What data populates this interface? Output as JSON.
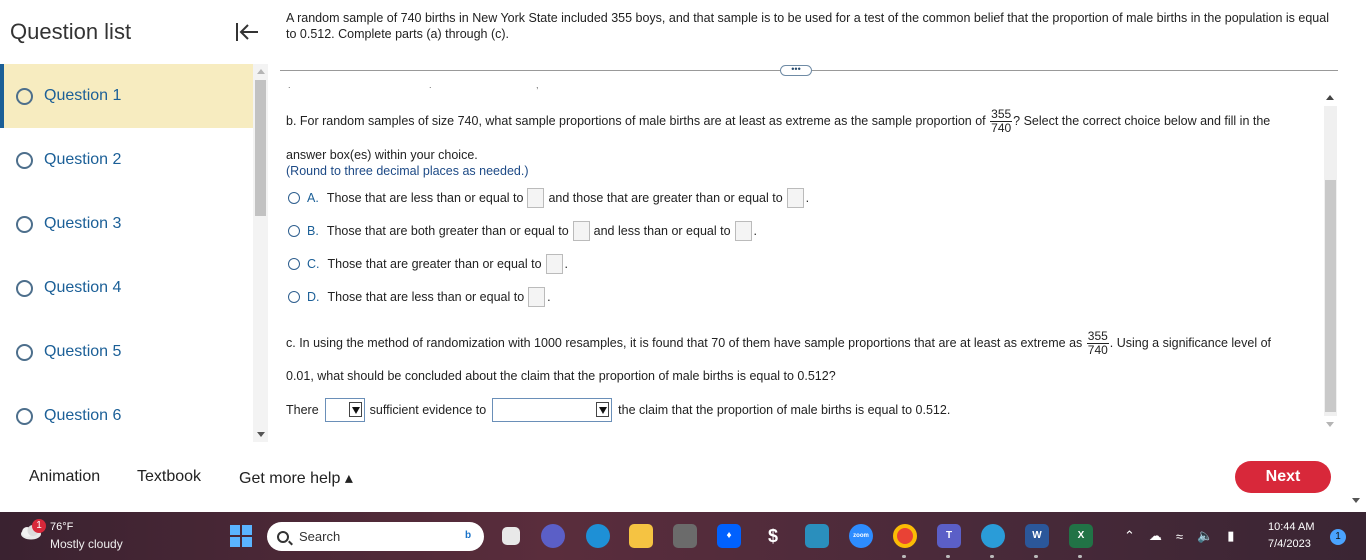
{
  "sidebar": {
    "title": "Question list",
    "collapse_icon": "collapse-left-icon",
    "questions": [
      {
        "label": "Question 1",
        "active": true
      },
      {
        "label": "Question 2",
        "active": false
      },
      {
        "label": "Question 3",
        "active": false
      },
      {
        "label": "Question 4",
        "active": false
      },
      {
        "label": "Question 5",
        "active": false
      },
      {
        "label": "Question 6",
        "active": false
      }
    ]
  },
  "question": {
    "prompt": "A random sample of 740 births in New York State included 355 boys, and that sample is to be used for a test of the common belief that the proportion of male births in the population is equal to 0.512. Complete parts (a) through (c).",
    "more_button": "•••",
    "part_b": {
      "text_before": "b. For random samples of size 740, what sample proportions of male births are at least as extreme as the sample proportion of",
      "frac_num": "355",
      "frac_den": "740",
      "text_after": "? Select the correct choice below and fill in the",
      "line2": "answer box(es) within your choice.",
      "hint": "(Round to three decimal places as needed.)",
      "choices": [
        {
          "letter": "A.",
          "text1": "Those that are less than or equal to",
          "text2": "and those that are greater than or equal to",
          "boxes": 2
        },
        {
          "letter": "B.",
          "text1": "Those that are both greater than or equal to",
          "text2": "and less than or equal to",
          "boxes": 2
        },
        {
          "letter": "C.",
          "text1": "Those that are greater than or equal to",
          "text2": "",
          "boxes": 1
        },
        {
          "letter": "D.",
          "text1": "Those that are less than or equal to",
          "text2": "",
          "boxes": 1
        }
      ]
    },
    "part_c": {
      "text_before": "c. In using the method of randomization with 1000 resamples, it is found that 70 of them have sample proportions that are at least as extreme as",
      "frac_num": "355",
      "frac_den": "740",
      "text_after": ". Using a significance level of",
      "line2": "0.01, what should be concluded about the claim that the proportion of male births is equal to 0.512?",
      "answer_prefix": "There",
      "answer_mid": "sufficient evidence to",
      "answer_suffix": "the claim that the proportion of male births is equal to 0.512."
    }
  },
  "bottom": {
    "animation": "Animation",
    "textbook": "Textbook",
    "get_more_help": "Get more help ▴",
    "next": "Next"
  },
  "taskbar": {
    "weather_badge": "1",
    "temperature": "76°F",
    "weather": "Mostly cloudy",
    "search_placeholder": "Search",
    "time": "10:44 AM",
    "date": "7/4/2023",
    "notification_count": "1",
    "apps": [
      "bing-icon",
      "file-icon",
      "teams-meet-icon",
      "edge-icon",
      "explorer-icon",
      "calculator-icon",
      "dropbox-icon",
      "trading-icon",
      "store-icon",
      "zoom-icon",
      "chrome-icon",
      "teams-icon",
      "edge-dev-icon",
      "word-icon",
      "excel-icon"
    ]
  }
}
